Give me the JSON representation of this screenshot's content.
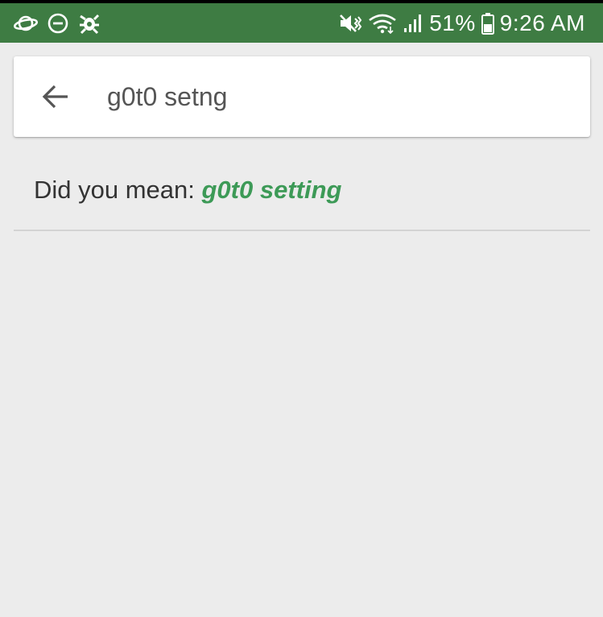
{
  "status_bar": {
    "left_icons": [
      "saturn-icon",
      "do-not-disturb-icon",
      "bug-icon"
    ],
    "right_icons": [
      "mute-vibrate-icon",
      "wifi-icon",
      "signal-icon",
      "battery-icon"
    ],
    "battery_percent": "51%",
    "time": "9:26 AM",
    "background_color": "#3e7c43"
  },
  "search": {
    "query": "g0t0 setng",
    "back_icon": "back-arrow-icon"
  },
  "suggestion": {
    "prefix": "Did you mean: ",
    "suggested_query": "g0t0 setting",
    "link_color": "#3d9a57"
  },
  "colors": {
    "page_background": "#ececec",
    "card_background": "#ffffff"
  }
}
